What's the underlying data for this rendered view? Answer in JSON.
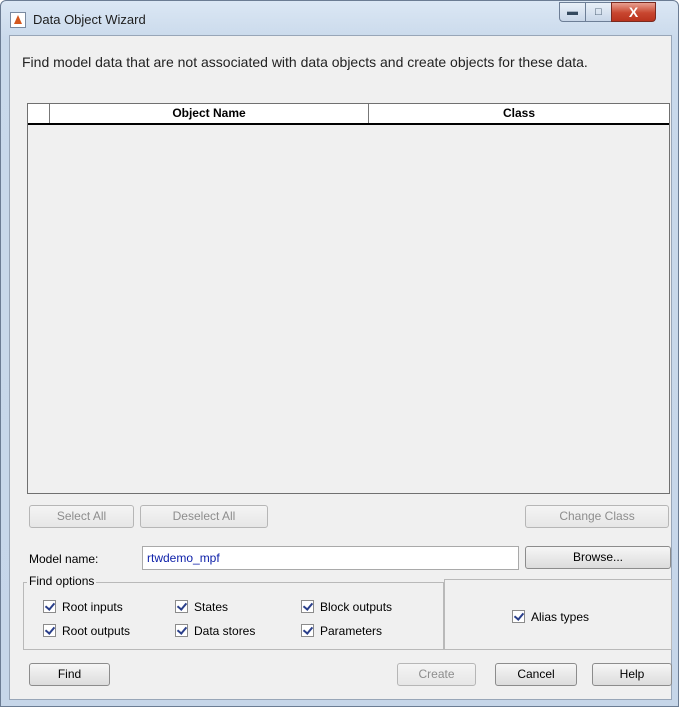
{
  "window": {
    "title": "Data Object Wizard"
  },
  "description": "Find model data that are not associated with data objects and create objects for these data.",
  "table": {
    "columns": [
      "",
      "Object Name",
      "Class"
    ],
    "rows": []
  },
  "buttons": {
    "select_all": "Select All",
    "deselect_all": "Deselect All",
    "change_class": "Change Class",
    "browse": "Browse...",
    "find": "Find",
    "create": "Create",
    "cancel": "Cancel",
    "help": "Help"
  },
  "model": {
    "label": "Model name:",
    "value": "rtwdemo_mpf"
  },
  "find_options": {
    "title": "Find options",
    "root_inputs": {
      "label": "Root inputs",
      "checked": true
    },
    "root_outputs": {
      "label": "Root outputs",
      "checked": true
    },
    "states": {
      "label": "States",
      "checked": true
    },
    "data_stores": {
      "label": "Data stores",
      "checked": true
    },
    "block_outputs": {
      "label": "Block outputs",
      "checked": true
    },
    "parameters": {
      "label": "Parameters",
      "checked": true
    }
  },
  "alias_types": {
    "label": "Alias types",
    "checked": true
  }
}
